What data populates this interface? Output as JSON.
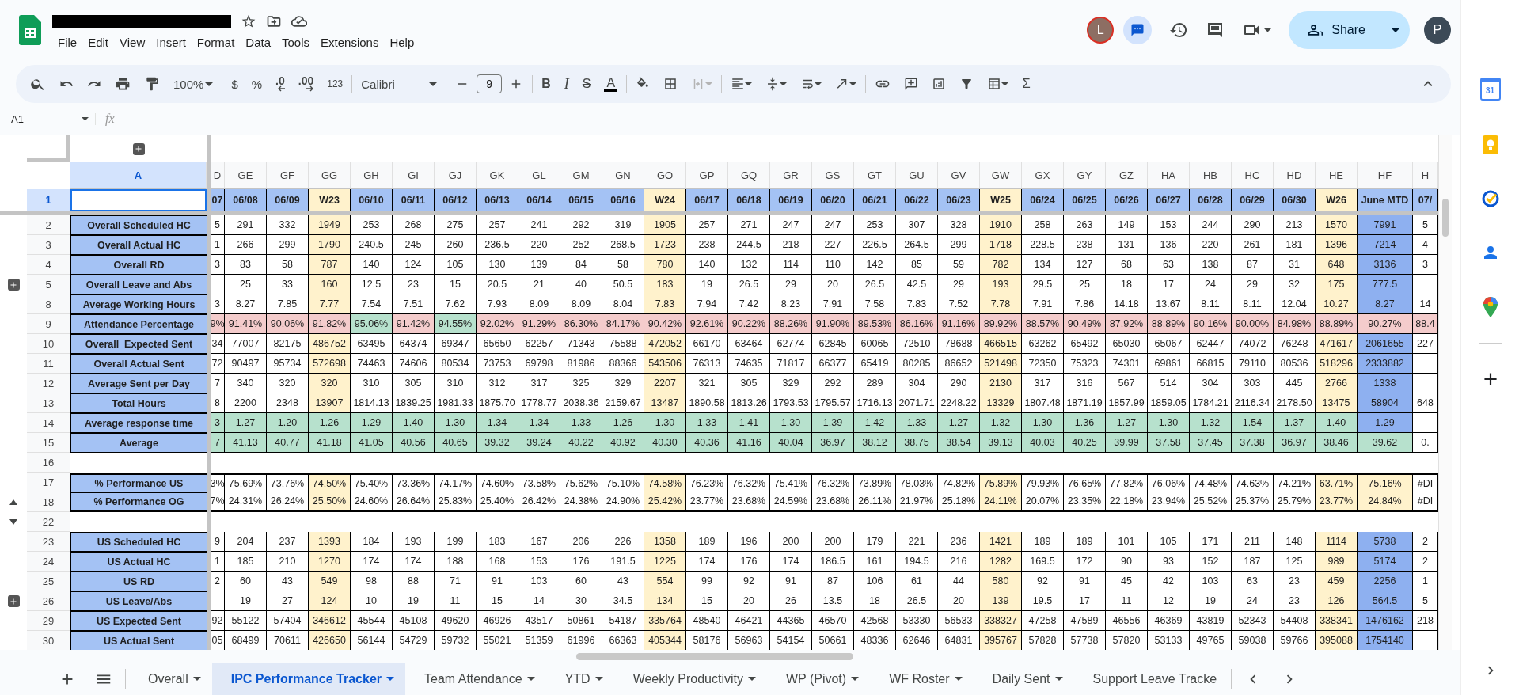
{
  "doc": {
    "redacted": true
  },
  "menu": [
    "File",
    "Edit",
    "View",
    "Insert",
    "Format",
    "Data",
    "Tools",
    "Extensions",
    "Help"
  ],
  "toolbar": {
    "zoom": "100%",
    "currency": "$",
    "percent": "%",
    "decrease_decimals": ".0",
    "increase_decimals": ".00",
    "number_format": "123",
    "font": "Calibri",
    "font_size": "9",
    "bold": "B",
    "italic": "I",
    "strikethrough": "S",
    "text_color": "A",
    "functions": "Σ"
  },
  "account": {
    "collaborator_initial": "L",
    "share": "Share",
    "user_initial": "P"
  },
  "formula_bar": {
    "name_box": "A1",
    "fx": "fx"
  },
  "side_panel": {
    "calendar_day": "31"
  },
  "label_column": "A",
  "columns": [
    {
      "letter": "D",
      "kind": "cut",
      "date": "07"
    },
    {
      "letter": "GE",
      "kind": "day",
      "date": "06/08"
    },
    {
      "letter": "GF",
      "kind": "day",
      "date": "06/09"
    },
    {
      "letter": "GG",
      "kind": "week",
      "date": "W23"
    },
    {
      "letter": "GH",
      "kind": "day",
      "date": "06/10"
    },
    {
      "letter": "GI",
      "kind": "day",
      "date": "06/11"
    },
    {
      "letter": "GJ",
      "kind": "day",
      "date": "06/12"
    },
    {
      "letter": "GK",
      "kind": "day",
      "date": "06/13"
    },
    {
      "letter": "GL",
      "kind": "day",
      "date": "06/14"
    },
    {
      "letter": "GM",
      "kind": "day",
      "date": "06/15"
    },
    {
      "letter": "GN",
      "kind": "day",
      "date": "06/16"
    },
    {
      "letter": "GO",
      "kind": "week",
      "date": "W24"
    },
    {
      "letter": "GP",
      "kind": "day",
      "date": "06/17"
    },
    {
      "letter": "GQ",
      "kind": "day",
      "date": "06/18"
    },
    {
      "letter": "GR",
      "kind": "day",
      "date": "06/19"
    },
    {
      "letter": "GS",
      "kind": "day",
      "date": "06/20"
    },
    {
      "letter": "GT",
      "kind": "day",
      "date": "06/21"
    },
    {
      "letter": "GU",
      "kind": "day",
      "date": "06/22"
    },
    {
      "letter": "GV",
      "kind": "day",
      "date": "06/23"
    },
    {
      "letter": "GW",
      "kind": "week",
      "date": "W25"
    },
    {
      "letter": "GX",
      "kind": "day",
      "date": "06/24"
    },
    {
      "letter": "GY",
      "kind": "day",
      "date": "06/25"
    },
    {
      "letter": "GZ",
      "kind": "day",
      "date": "06/26"
    },
    {
      "letter": "HA",
      "kind": "day",
      "date": "06/27"
    },
    {
      "letter": "HB",
      "kind": "day",
      "date": "06/28"
    },
    {
      "letter": "HC",
      "kind": "day",
      "date": "06/29"
    },
    {
      "letter": "HD",
      "kind": "day",
      "date": "06/30"
    },
    {
      "letter": "HE",
      "kind": "week",
      "date": "W26"
    },
    {
      "letter": "HF",
      "kind": "total",
      "date": "June MTD"
    },
    {
      "letter": "H",
      "kind": "cut",
      "date": "07/"
    }
  ],
  "header_row": {
    "number": "1",
    "label_selected": true
  },
  "rows": [
    {
      "number": "2",
      "kind": "data",
      "label": "Overall Scheduled HC",
      "left_cut": "5",
      "values": [
        "291",
        "332",
        "1949",
        "253",
        "268",
        "275",
        "257",
        "241",
        "292",
        "319",
        "1905",
        "257",
        "271",
        "247",
        "247",
        "253",
        "307",
        "328",
        "1910",
        "258",
        "263",
        "149",
        "153",
        "244",
        "290",
        "213",
        "1570",
        "7991"
      ],
      "right_cut": "5"
    },
    {
      "number": "3",
      "kind": "data",
      "label": "Overall Actual HC",
      "left_cut": "1",
      "values": [
        "266",
        "299",
        "1790",
        "240.5",
        "245",
        "260",
        "236.5",
        "220",
        "252",
        "268.5",
        "1723",
        "238",
        "244.5",
        "218",
        "227",
        "226.5",
        "264.5",
        "299",
        "1718",
        "228.5",
        "238",
        "131",
        "136",
        "220",
        "261",
        "181",
        "1396",
        "7214"
      ],
      "right_cut": "4"
    },
    {
      "number": "4",
      "kind": "data",
      "label": "Overall RD",
      "left_cut": "3",
      "values": [
        "83",
        "58",
        "787",
        "140",
        "124",
        "105",
        "130",
        "139",
        "84",
        "58",
        "780",
        "140",
        "132",
        "114",
        "110",
        "142",
        "85",
        "59",
        "782",
        "134",
        "127",
        "68",
        "63",
        "138",
        "87",
        "31",
        "648",
        "3136"
      ],
      "right_cut": "3"
    },
    {
      "number": "5",
      "kind": "data",
      "label": "Overall Leave and Abs",
      "group_collapsed": true,
      "values": [
        "25",
        "33",
        "160",
        "12.5",
        "23",
        "15",
        "20.5",
        "21",
        "40",
        "50.5",
        "183",
        "19",
        "26.5",
        "29",
        "20",
        "26.5",
        "42.5",
        "29",
        "193",
        "29.5",
        "25",
        "18",
        "17",
        "24",
        "29",
        "32",
        "175",
        "777.5"
      ]
    },
    {
      "number": "8",
      "kind": "data",
      "label": "Average Working Hours",
      "left_cut": "3",
      "values": [
        "8.27",
        "7.85",
        "7.77",
        "7.54",
        "7.51",
        "7.62",
        "7.93",
        "8.09",
        "8.09",
        "8.04",
        "7.83",
        "7.94",
        "7.42",
        "8.23",
        "7.91",
        "7.58",
        "7.83",
        "7.52",
        "7.78",
        "7.91",
        "7.86",
        "14.18",
        "13.67",
        "8.11",
        "8.11",
        "12.04",
        "10.27",
        "8.27"
      ],
      "right_cut": "14"
    },
    {
      "number": "9",
      "kind": "status",
      "label": "Attendance Percentage",
      "left_cut": "9%",
      "values": [
        "91.41%",
        "90.06%",
        "91.82%",
        "95.06%",
        "91.42%",
        "94.55%",
        "92.02%",
        "91.29%",
        "86.30%",
        "84.17%",
        "90.42%",
        "92.61%",
        "90.22%",
        "88.26%",
        "91.90%",
        "89.53%",
        "86.16%",
        "91.16%",
        "89.92%",
        "88.57%",
        "90.49%",
        "87.92%",
        "88.89%",
        "90.16%",
        "90.00%",
        "84.98%",
        "88.89%",
        "90.27%"
      ],
      "right_cut": "88.4",
      "on_target": [
        false,
        false,
        false,
        false,
        true,
        false,
        true,
        false,
        false,
        false,
        false,
        false,
        false,
        false,
        false,
        false,
        false,
        false,
        false,
        false,
        false,
        false,
        false,
        false,
        false,
        false,
        false,
        false,
        false,
        false
      ]
    },
    {
      "number": "10",
      "kind": "data",
      "label": "Overall  Expected Sent",
      "left_cut": "34",
      "values": [
        "77007",
        "82175",
        "486752",
        "63495",
        "64374",
        "69347",
        "65650",
        "62257",
        "71343",
        "75588",
        "472052",
        "66170",
        "63464",
        "62774",
        "62845",
        "60065",
        "72510",
        "78688",
        "466515",
        "63262",
        "65492",
        "65030",
        "65067",
        "62447",
        "74072",
        "76248",
        "471617",
        "2061655"
      ],
      "right_cut": "227"
    },
    {
      "number": "11",
      "kind": "data",
      "label": "Overall Actual Sent",
      "left_cut": "72",
      "values": [
        "90497",
        "95734",
        "572698",
        "74463",
        "74606",
        "80534",
        "73753",
        "69798",
        "81986",
        "88366",
        "543506",
        "76313",
        "74635",
        "71817",
        "66377",
        "65419",
        "80285",
        "86652",
        "521498",
        "72350",
        "75323",
        "74301",
        "69861",
        "66815",
        "79110",
        "80536",
        "518296",
        "2333882"
      ]
    },
    {
      "number": "12",
      "kind": "data",
      "label": "Average Sent per Day",
      "left_cut": "7",
      "values": [
        "340",
        "320",
        "320",
        "310",
        "305",
        "310",
        "312",
        "317",
        "325",
        "329",
        "2207",
        "321",
        "305",
        "329",
        "292",
        "289",
        "304",
        "290",
        "2130",
        "317",
        "316",
        "567",
        "514",
        "304",
        "303",
        "445",
        "2766",
        "1338"
      ]
    },
    {
      "number": "13",
      "kind": "data",
      "label": "Total Hours",
      "left_cut": "8",
      "values": [
        "2200",
        "2348",
        "13907",
        "1814.13",
        "1839.25",
        "1981.33",
        "1875.70",
        "1778.77",
        "2038.36",
        "2159.67",
        "13487",
        "1890.58",
        "1813.26",
        "1793.53",
        "1795.57",
        "1716.13",
        "2071.71",
        "2248.22",
        "13329",
        "1807.48",
        "1871.19",
        "1857.99",
        "1859.05",
        "1784.21",
        "2116.34",
        "2178.50",
        "13475",
        "58904"
      ],
      "right_cut": "648"
    },
    {
      "number": "14",
      "kind": "response",
      "label": "Average response time",
      "left_cut": "3",
      "values": [
        "1.27",
        "1.20",
        "1.26",
        "1.29",
        "1.40",
        "1.30",
        "1.34",
        "1.34",
        "1.33",
        "1.26",
        "1.30",
        "1.33",
        "1.41",
        "1.30",
        "1.39",
        "1.42",
        "1.33",
        "1.27",
        "1.32",
        "1.30",
        "1.36",
        "1.27",
        "1.30",
        "1.32",
        "1.54",
        "1.37",
        "1.40",
        "1.29"
      ]
    },
    {
      "number": "15",
      "kind": "average",
      "label": "Average",
      "left_cut": "7",
      "values": [
        "41.13",
        "40.77",
        "41.18",
        "41.05",
        "40.56",
        "40.65",
        "39.32",
        "39.24",
        "40.22",
        "40.92",
        "40.30",
        "40.36",
        "41.16",
        "40.04",
        "36.97",
        "38.12",
        "38.75",
        "38.54",
        "39.13",
        "40.03",
        "40.25",
        "39.99",
        "37.58",
        "37.45",
        "37.38",
        "36.97",
        "38.46",
        "39.62"
      ],
      "right_cut": "0."
    },
    {
      "number": "16",
      "kind": "blank"
    },
    {
      "number": "17",
      "kind": "pct",
      "label": "% Performance US",
      "left_cut": "3%",
      "values": [
        "75.69%",
        "73.76%",
        "74.50%",
        "75.40%",
        "73.36%",
        "74.17%",
        "74.60%",
        "73.58%",
        "75.62%",
        "75.10%",
        "74.58%",
        "76.23%",
        "76.32%",
        "75.41%",
        "76.32%",
        "73.89%",
        "78.03%",
        "74.82%",
        "75.89%",
        "79.93%",
        "76.65%",
        "77.82%",
        "76.06%",
        "74.48%",
        "74.63%",
        "74.21%",
        "63.71%",
        "75.16%"
      ],
      "right_cut": "#DI"
    },
    {
      "number": "18",
      "kind": "pct",
      "label": "% Performance OG",
      "group_end": true,
      "left_cut": "7%",
      "values": [
        "24.31%",
        "26.24%",
        "25.50%",
        "24.60%",
        "26.64%",
        "25.83%",
        "25.40%",
        "26.42%",
        "24.38%",
        "24.90%",
        "25.42%",
        "23.77%",
        "23.68%",
        "24.59%",
        "23.68%",
        "26.11%",
        "21.97%",
        "25.18%",
        "24.11%",
        "20.07%",
        "23.35%",
        "22.18%",
        "23.94%",
        "25.52%",
        "25.37%",
        "25.79%",
        "23.77%",
        "24.84%"
      ],
      "right_cut": "#DI"
    },
    {
      "number": "22",
      "kind": "blank",
      "group_start": true
    },
    {
      "number": "23",
      "kind": "data",
      "label": "US Scheduled HC",
      "left_cut": "9",
      "values": [
        "204",
        "237",
        "1393",
        "184",
        "193",
        "199",
        "183",
        "167",
        "206",
        "226",
        "1358",
        "189",
        "196",
        "200",
        "200",
        "179",
        "221",
        "236",
        "1421",
        "189",
        "189",
        "101",
        "105",
        "171",
        "211",
        "148",
        "1114",
        "5738"
      ],
      "right_cut": "2"
    },
    {
      "number": "24",
      "kind": "data",
      "label": "US Actual HC",
      "left_cut": "1",
      "values": [
        "185",
        "210",
        "1270",
        "174",
        "174",
        "188",
        "168",
        "153",
        "176",
        "191.5",
        "1225",
        "174",
        "176",
        "174",
        "186.5",
        "161",
        "194.5",
        "216",
        "1282",
        "169.5",
        "172",
        "90",
        "93",
        "152",
        "187",
        "125",
        "989",
        "5174"
      ],
      "right_cut": "2"
    },
    {
      "number": "25",
      "kind": "data",
      "label": "US RD",
      "left_cut": "2",
      "values": [
        "60",
        "43",
        "549",
        "98",
        "88",
        "71",
        "91",
        "103",
        "60",
        "43",
        "554",
        "99",
        "92",
        "91",
        "87",
        "106",
        "61",
        "44",
        "580",
        "92",
        "91",
        "45",
        "42",
        "103",
        "63",
        "23",
        "459",
        "2256"
      ],
      "right_cut": "1"
    },
    {
      "number": "26",
      "kind": "data",
      "label": "US Leave/Abs",
      "group_collapsed": true,
      "values": [
        "19",
        "27",
        "124",
        "10",
        "19",
        "11",
        "15",
        "14",
        "30",
        "34.5",
        "134",
        "15",
        "20",
        "26",
        "13.5",
        "18",
        "26.5",
        "20",
        "139",
        "19.5",
        "17",
        "11",
        "12",
        "19",
        "24",
        "23",
        "126",
        "564.5"
      ],
      "right_cut": "5"
    },
    {
      "number": "29",
      "kind": "data",
      "label": "US Expected Sent",
      "left_cut": "92",
      "values": [
        "55122",
        "57404",
        "346612",
        "45544",
        "45108",
        "49620",
        "46926",
        "43517",
        "50861",
        "54187",
        "335764",
        "48540",
        "46421",
        "44365",
        "46570",
        "42568",
        "53330",
        "56533",
        "338327",
        "47258",
        "47589",
        "46556",
        "46369",
        "43819",
        "52343",
        "54408",
        "338341",
        "1476162"
      ],
      "right_cut": "218"
    },
    {
      "number": "30",
      "kind": "data",
      "label": "US Actual Sent",
      "left_cut": "05",
      "values": [
        "68499",
        "70611",
        "426650",
        "56144",
        "54729",
        "59732",
        "55021",
        "51359",
        "61996",
        "66363",
        "405344",
        "58176",
        "56963",
        "54154",
        "50661",
        "48336",
        "62646",
        "64831",
        "395767",
        "57828",
        "57738",
        "57820",
        "53133",
        "49765",
        "59038",
        "59766",
        "395088",
        "1754140"
      ]
    }
  ],
  "sheet_tabs": [
    {
      "label": "Overall",
      "selected": false,
      "menu_visible": true
    },
    {
      "label": "IPC Performance Tracker",
      "selected": true,
      "menu_visible": true
    },
    {
      "label": "Team Attendance",
      "selected": false,
      "menu_visible": true
    },
    {
      "label": "YTD",
      "selected": false,
      "menu_visible": true
    },
    {
      "label": "Weekly Productivity",
      "selected": false,
      "menu_visible": true
    },
    {
      "label": "WP (Pivot)",
      "selected": false,
      "menu_visible": true
    },
    {
      "label": "WF Roster",
      "selected": false,
      "menu_visible": true
    },
    {
      "label": "Daily Sent",
      "selected": false,
      "menu_visible": true
    },
    {
      "label": "Support Leave Tracke",
      "selected": false,
      "menu_visible": false
    }
  ]
}
